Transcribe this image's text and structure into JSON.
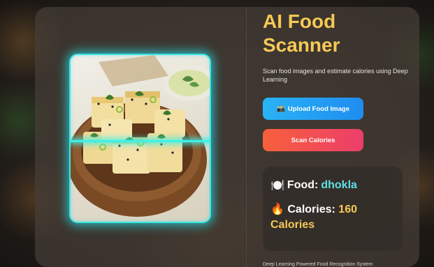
{
  "app": {
    "title": "AI Food Scanner",
    "subtitle": "Scan food images and estimate calories using Deep Learning",
    "footer": "Deep Learning Powered Food Recognition System"
  },
  "buttons": {
    "upload_icon": "📸",
    "upload_label": "Upload Food Image",
    "scan_label": "Scan Calories"
  },
  "result": {
    "food_icon": "🍽️",
    "food_label": "Food:",
    "food_value": "dhokla",
    "calories_icon": "🔥",
    "calories_label": "Calories:",
    "calories_value": "160",
    "calories_unit": "Calories"
  },
  "colors": {
    "accent_title": "#f6c955",
    "scan_glow": "#38e6e6",
    "upload_button": "#1f8cf0",
    "scan_button": "#ec3e6b",
    "food_value": "#5fe0e6"
  },
  "icons": {
    "upload": "camera-icon",
    "food": "plate-icon",
    "calories": "fire-icon"
  },
  "image": {
    "subject": "food-photo"
  }
}
